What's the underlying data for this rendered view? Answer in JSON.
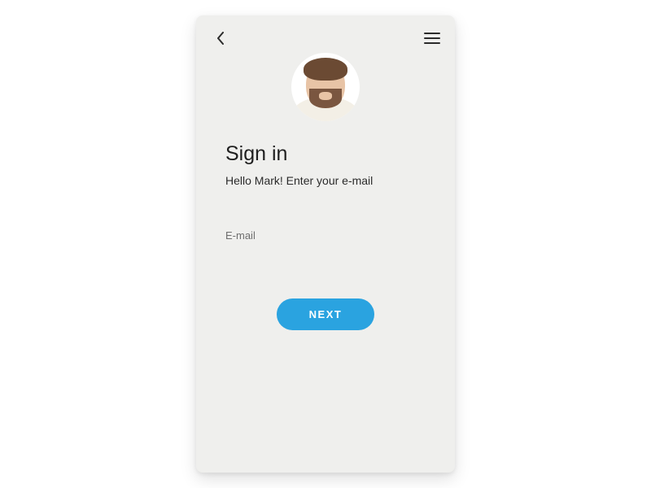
{
  "header": {
    "back_icon": "chevron-left",
    "menu_icon": "hamburger"
  },
  "avatar": {
    "alt": "user-avatar"
  },
  "signin": {
    "title": "Sign in",
    "subtitle": "Hello Mark! Enter your e-mail",
    "email_label": "E-mail",
    "email_value": "",
    "email_placeholder": "",
    "next_label": "NEXT"
  },
  "colors": {
    "accent": "#2aa3e0",
    "background": "#efefed"
  }
}
